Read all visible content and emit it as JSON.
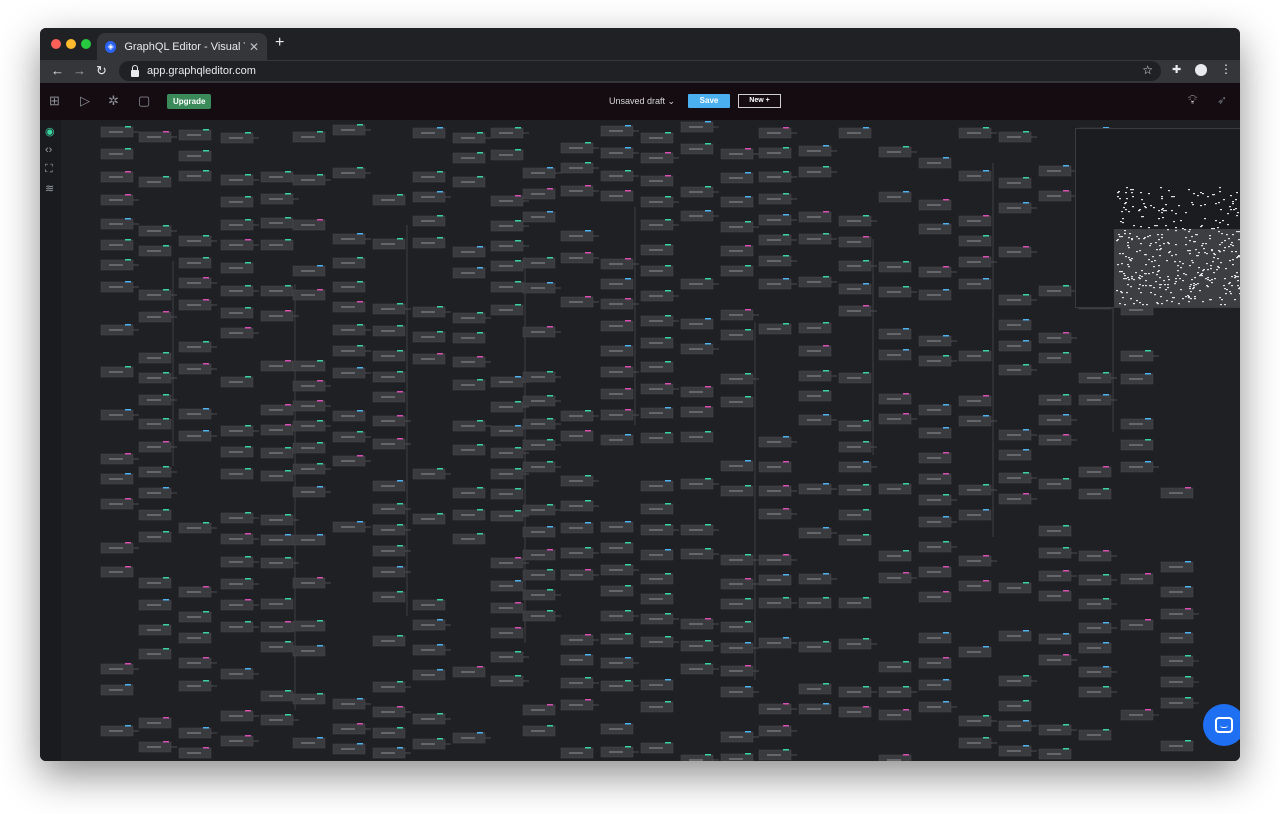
{
  "browser": {
    "tab_title": "GraphQL Editor - Visual Tool for GraphQL",
    "url": "app.graphqleditor.com"
  },
  "header": {
    "upgrade_label": "Upgrade",
    "draft_label": "Unsaved draft",
    "save_label": "Save",
    "new_label": "New +"
  },
  "colors": {
    "accent_save": "#4bb0f0",
    "upgrade": "#3b8a5a",
    "node": "#3a3b3e",
    "chat": "#1f6ff2"
  },
  "icons": [
    "dashboard-icon",
    "play-icon",
    "settings-icon",
    "book-icon",
    "lightbulb-icon",
    "rocket-icon",
    "eye-icon",
    "code-icon",
    "fullscreen-icon",
    "layers-icon",
    "chat-icon"
  ]
}
